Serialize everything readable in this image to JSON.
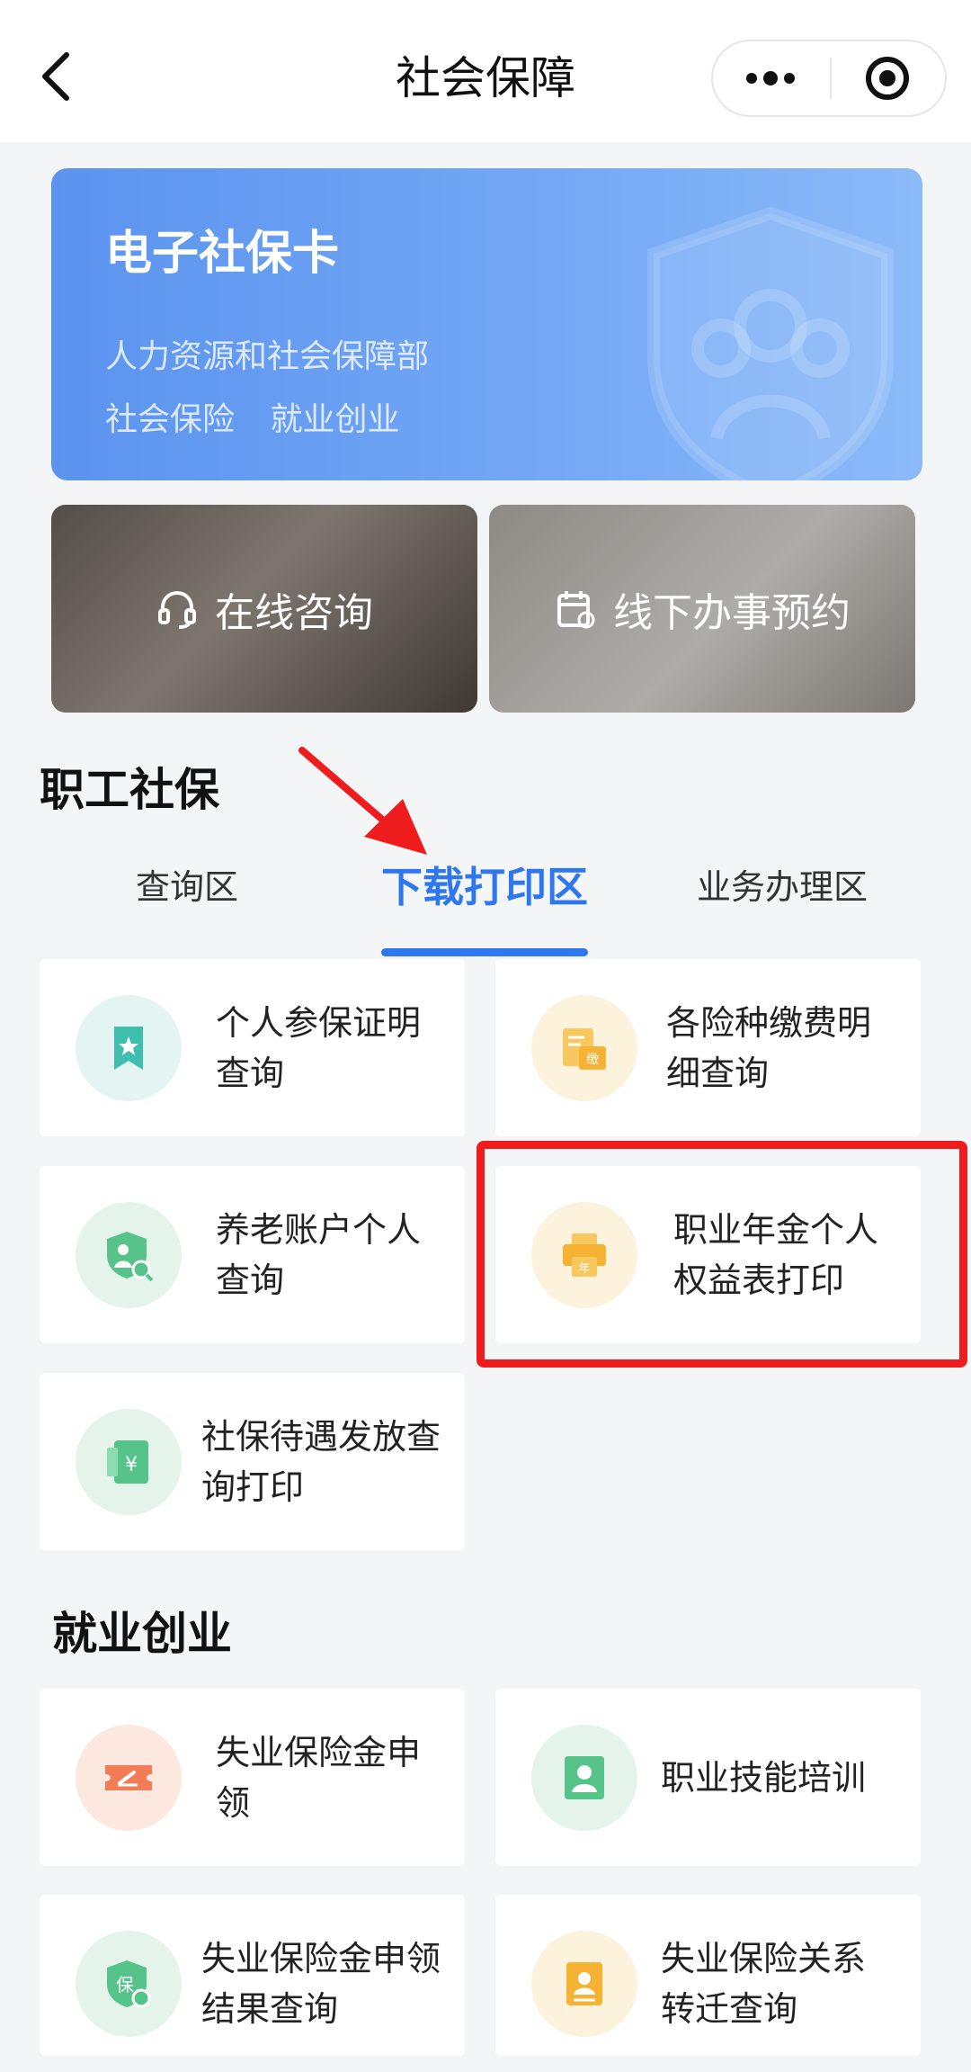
{
  "nav": {
    "title": "社会保障"
  },
  "banner": {
    "title": "电子社保卡",
    "line1": "人力资源和社会保障部",
    "tags": [
      "社会保险",
      "就业创业"
    ]
  },
  "quick_links": [
    {
      "label": "在线咨询",
      "icon": "headset-icon"
    },
    {
      "label": "线下办事预约",
      "icon": "calendar-icon"
    }
  ],
  "section1": {
    "title": "职工社保",
    "tabs": [
      "查询区",
      "下载打印区",
      "业务办理区"
    ],
    "active_tab": "下载打印区",
    "cards": [
      {
        "label": "个人参保证明查询",
        "icon": "certificate-icon",
        "color": "#e4f4f2"
      },
      {
        "label": "各险种缴费明细查询",
        "icon": "payment-detail-icon",
        "color": "#fdf2dc"
      },
      {
        "label": "养老账户个人查询",
        "icon": "pension-search-icon",
        "color": "#e5f4ea"
      },
      {
        "label": "职业年金个人权益表打印",
        "icon": "printer-icon",
        "color": "#fdf2dc"
      },
      {
        "label": "社保待遇发放查询打印",
        "icon": "yuan-document-icon",
        "color": "#e5f4ea"
      }
    ]
  },
  "section2": {
    "title": "就业创业",
    "cards": [
      {
        "label": "失业保险金申领",
        "icon": "ticket-icon",
        "color": "#fde8df"
      },
      {
        "label": "职业技能培训",
        "icon": "profile-card-icon",
        "color": "#e5f4ea"
      },
      {
        "label": "失业保险金申领结果查询",
        "icon": "insurance-search-icon",
        "color": "#e5f4ea"
      },
      {
        "label": "失业保险关系转迁查询",
        "icon": "transfer-doc-icon",
        "color": "#fdf2dc"
      }
    ]
  },
  "colors": {
    "accent": "#2e77ee",
    "highlight": "#ee1c1c"
  }
}
